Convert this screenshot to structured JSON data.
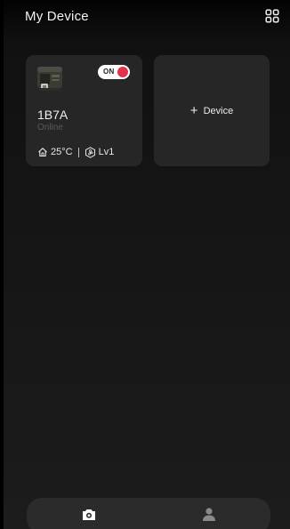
{
  "header": {
    "title": "My Device",
    "menu_icon": "grid-icon"
  },
  "devices": [
    {
      "name": "1B7A",
      "status": "Online",
      "power_label": "ON",
      "power_on": true,
      "temperature": "25°C",
      "level": "Lv1",
      "thumbnail_icon": "heater-device-icon"
    }
  ],
  "add_card": {
    "label": "Device",
    "icon": "plus-icon"
  },
  "bottom_nav": {
    "items": [
      {
        "icon": "device-icon",
        "active": true
      },
      {
        "icon": "user-icon",
        "active": false
      }
    ]
  },
  "colors": {
    "background": "#1c1c1c",
    "card": "#262626",
    "accent_red": "#e0334a",
    "status_gray": "#5a5a5a"
  }
}
